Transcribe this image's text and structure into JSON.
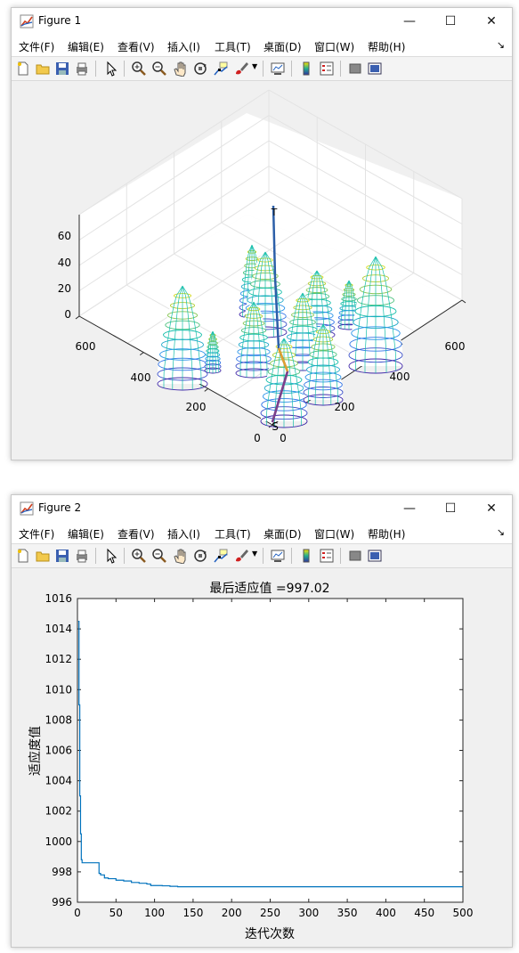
{
  "window1": {
    "title": "Figure 1",
    "menu": [
      "文件(F)",
      "编辑(E)",
      "查看(V)",
      "插入(I)",
      "工具(T)",
      "桌面(D)",
      "窗口(W)",
      "帮助(H)"
    ],
    "controls": {
      "minimize": "—",
      "maximize": "☐",
      "close": "✕"
    },
    "toolbar_icons": [
      "new-figure-icon",
      "open-file-icon",
      "save-icon",
      "print-icon",
      "select-arrow-icon",
      "zoom-in-icon",
      "zoom-out-icon",
      "pan-hand-icon",
      "rotate-3d-icon",
      "data-cursor-icon",
      "brush-icon",
      "link-plot-icon",
      "colorbar-icon",
      "legend-icon",
      "hide-plot-tools-icon",
      "show-plot-tools-icon"
    ],
    "plot": {
      "type": "3d-surface-path",
      "z_ticks": [
        "60",
        "40",
        "20",
        "0"
      ],
      "x_ticks": [
        "600",
        "400",
        "200",
        "0"
      ],
      "y_ticks": [
        "0",
        "200",
        "400",
        "600"
      ],
      "start_label": "S",
      "target_label": "T"
    }
  },
  "window2": {
    "title": "Figure 2",
    "menu": [
      "文件(F)",
      "编辑(E)",
      "查看(V)",
      "插入(I)",
      "工具(T)",
      "桌面(D)",
      "窗口(W)",
      "帮助(H)"
    ],
    "controls": {
      "minimize": "—",
      "maximize": "☐",
      "close": "✕"
    }
  },
  "chart_data": {
    "type": "line",
    "title": "最后适应值 =997.02",
    "xlabel": "迭代次数",
    "ylabel": "适应度值",
    "xlim": [
      0,
      500
    ],
    "ylim": [
      996,
      1016
    ],
    "xticks": [
      0,
      50,
      100,
      150,
      200,
      250,
      300,
      350,
      400,
      450,
      500
    ],
    "yticks": [
      996,
      998,
      1000,
      1002,
      1004,
      1006,
      1008,
      1010,
      1012,
      1014,
      1016
    ],
    "color": "#0072bd",
    "series": [
      {
        "x": [
          1,
          2,
          3,
          4,
          5,
          6,
          7,
          8,
          10,
          15,
          20,
          25,
          28,
          30,
          35,
          40,
          50,
          60,
          70,
          80,
          90,
          95,
          100,
          110,
          120,
          130,
          200,
          300,
          400,
          500
        ],
        "values": [
          1014.5,
          1009,
          1003,
          1000.5,
          998.8,
          998.6,
          998.6,
          998.6,
          998.6,
          998.6,
          998.6,
          998.6,
          997.9,
          997.8,
          997.6,
          997.55,
          997.45,
          997.4,
          997.3,
          997.25,
          997.2,
          997.1,
          997.1,
          997.08,
          997.05,
          997.02,
          997.02,
          997.02,
          997.02,
          997.02
        ]
      }
    ]
  }
}
